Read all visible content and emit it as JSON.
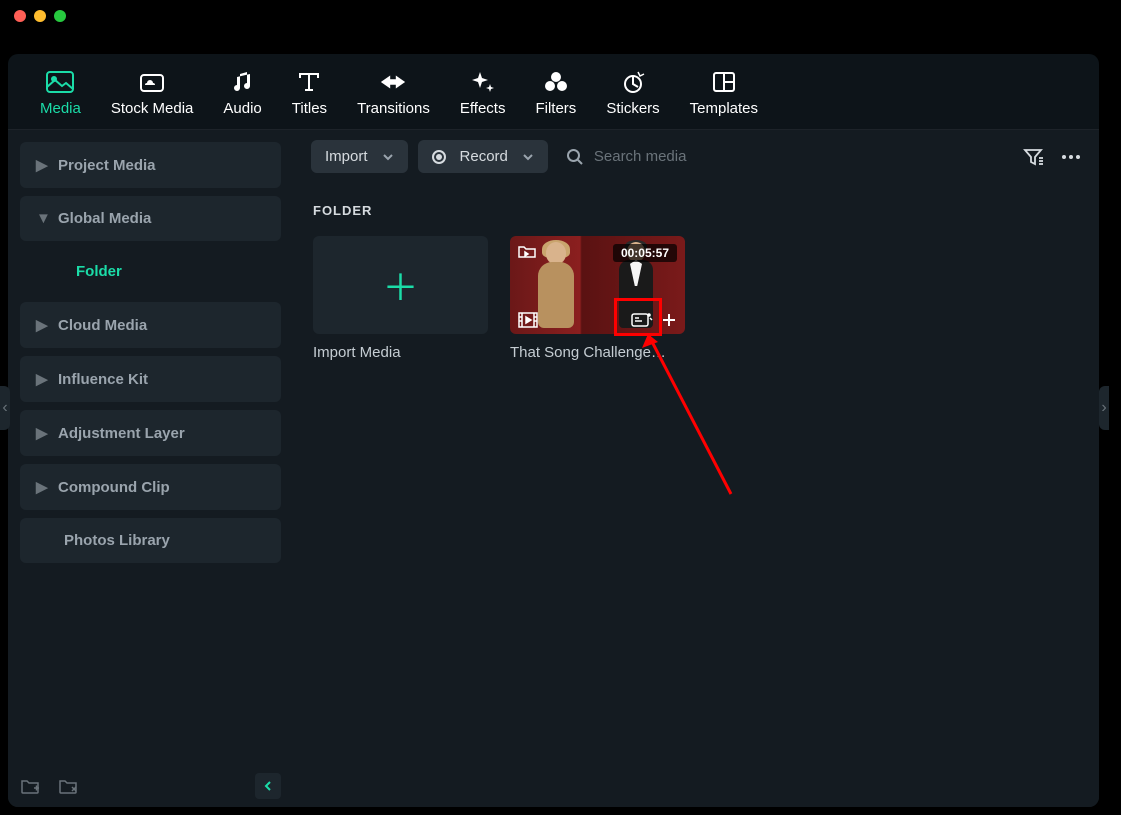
{
  "tabs": [
    {
      "label": "Media",
      "icon": "image"
    },
    {
      "label": "Stock Media",
      "icon": "cloud-image"
    },
    {
      "label": "Audio",
      "icon": "music"
    },
    {
      "label": "Titles",
      "icon": "text"
    },
    {
      "label": "Transitions",
      "icon": "transition"
    },
    {
      "label": "Effects",
      "icon": "sparkle"
    },
    {
      "label": "Filters",
      "icon": "circles"
    },
    {
      "label": "Stickers",
      "icon": "sticker"
    },
    {
      "label": "Templates",
      "icon": "layout"
    }
  ],
  "active_tab_index": 0,
  "sidebar": {
    "items": [
      {
        "label": "Project Media",
        "expandable": true,
        "expanded": false
      },
      {
        "label": "Global Media",
        "expandable": true,
        "expanded": true
      },
      {
        "label": "Folder",
        "child": true,
        "active": true
      },
      {
        "label": "Cloud Media",
        "expandable": true,
        "expanded": false
      },
      {
        "label": "Influence Kit",
        "expandable": true,
        "expanded": false
      },
      {
        "label": "Adjustment Layer",
        "expandable": true,
        "expanded": false
      },
      {
        "label": "Compound Clip",
        "expandable": true,
        "expanded": false
      },
      {
        "label": "Photos Library",
        "expandable": false
      }
    ]
  },
  "toolbar": {
    "import_label": "Import",
    "record_label": "Record",
    "search_placeholder": "Search media"
  },
  "content": {
    "section_title": "FOLDER",
    "tiles": [
      {
        "type": "import",
        "label": "Import Media"
      },
      {
        "type": "video",
        "label": "That Song Challenge…",
        "duration": "00:05:57"
      }
    ]
  }
}
